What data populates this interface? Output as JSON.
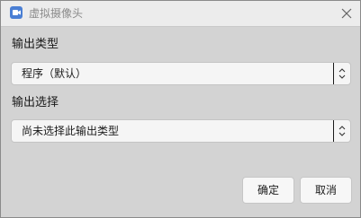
{
  "window": {
    "title": "虚拟摄像头"
  },
  "output_type": {
    "label": "输出类型",
    "selected": "程序（默认）"
  },
  "output_select": {
    "label": "输出选择",
    "selected": "尚未选择此输出类型"
  },
  "buttons": {
    "ok_label": "确定",
    "cancel_label": "取消"
  },
  "icons": {
    "app": "camera-app-icon",
    "close": "close-icon",
    "dropdown": "updown-chevron-icon"
  },
  "colors": {
    "app_icon": "#4a7fd4",
    "title_text": "#8a8a8a",
    "dialog_bg": "#d3d3d3"
  }
}
